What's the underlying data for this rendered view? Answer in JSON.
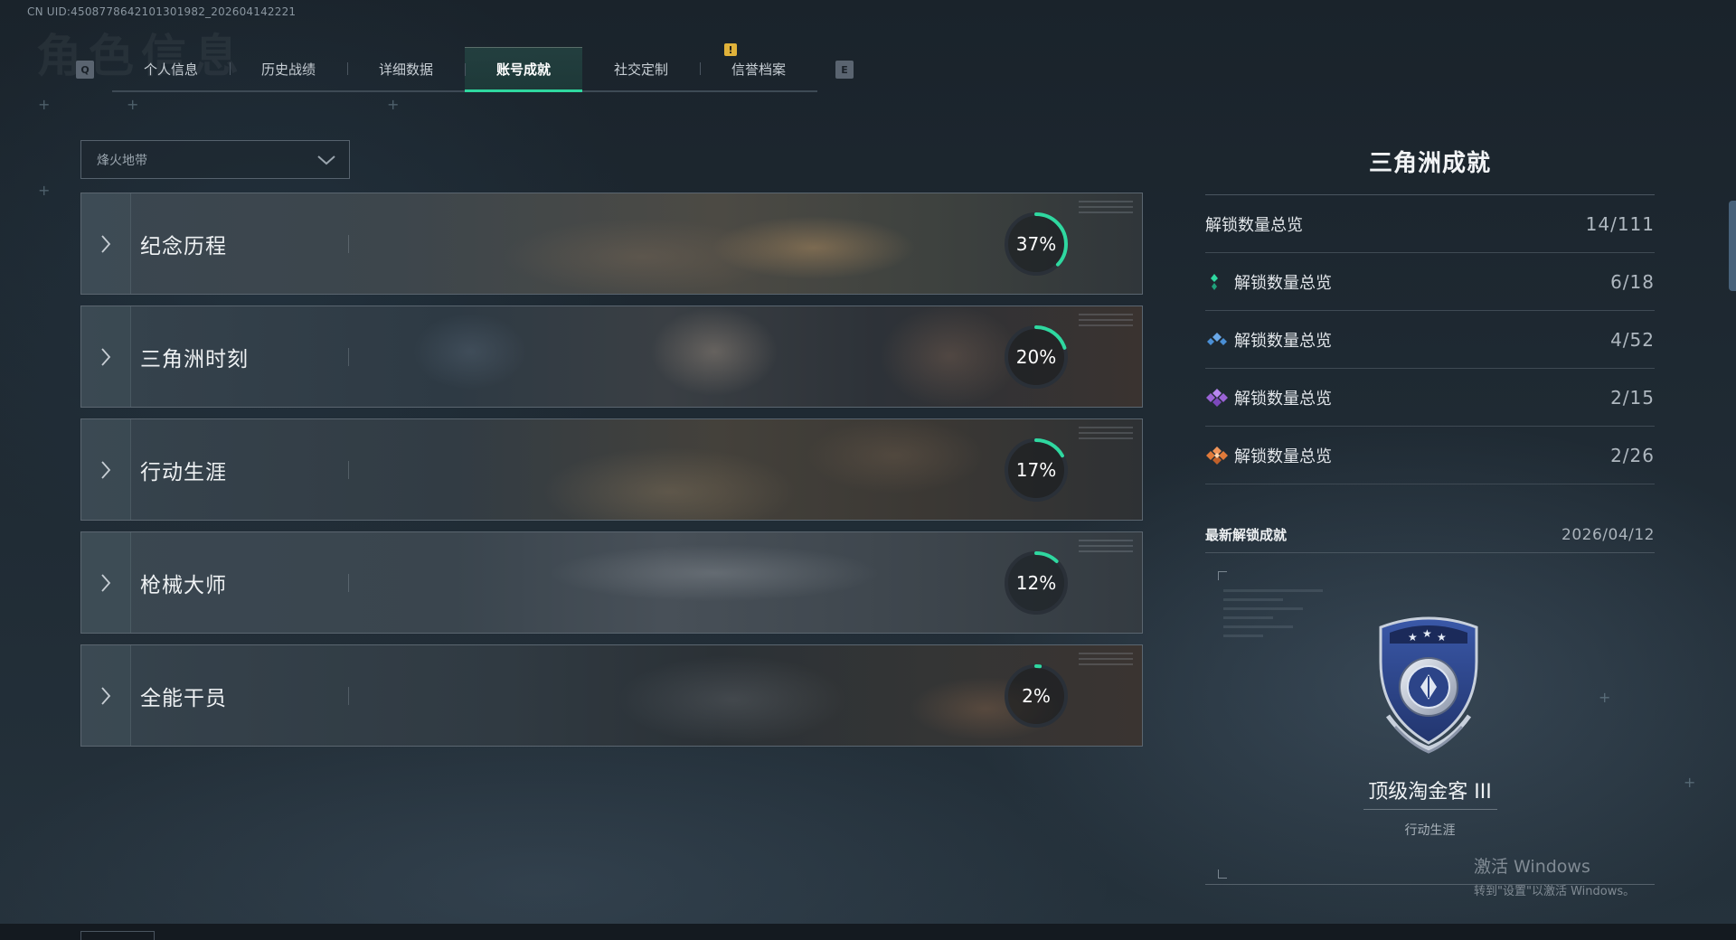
{
  "uid_text": "CN UID:4508778642101301982_202604142221",
  "bg_title": "角色信息",
  "nav": {
    "prev_key": "Q",
    "next_key": "E",
    "tabs": [
      {
        "label": "个人信息",
        "active": false
      },
      {
        "label": "历史战绩",
        "active": false
      },
      {
        "label": "详细数据",
        "active": false
      },
      {
        "label": "账号成就",
        "active": true
      },
      {
        "label": "社交定制",
        "active": false
      },
      {
        "label": "信誉档案",
        "active": false
      }
    ],
    "notice_badge": "!"
  },
  "mode_select": {
    "value": "烽火地带",
    "icon": "chevron-down-icon"
  },
  "categories": [
    {
      "name": "纪念历程",
      "code": "001",
      "percent": 37,
      "percent_label": "37%"
    },
    {
      "name": "三角洲时刻",
      "code": "002",
      "percent": 20,
      "percent_label": "20%"
    },
    {
      "name": "行动生涯",
      "code": "003",
      "percent": 17,
      "percent_label": "17%"
    },
    {
      "name": "枪械大师",
      "code": "004",
      "percent": 12,
      "percent_label": "12%"
    },
    {
      "name": "全能干员",
      "code": "005",
      "percent": 2,
      "percent_label": "2%"
    }
  ],
  "panel": {
    "title": "三角洲成就",
    "total": {
      "label": "解锁数量总览",
      "value": "14/111"
    },
    "tiers": [
      {
        "label": "解锁数量总览",
        "value": "6/18",
        "icon": "green-gem-icon",
        "color": "#2fd8a0"
      },
      {
        "label": "解锁数量总览",
        "value": "4/52",
        "icon": "blue-gem-icon",
        "color": "#4a8fd6"
      },
      {
        "label": "解锁数量总览",
        "value": "2/15",
        "icon": "purple-gem-icon",
        "color": "#9a63d6"
      },
      {
        "label": "解锁数量总览",
        "value": "2/26",
        "icon": "orange-gem-icon",
        "color": "#e07a3a"
      }
    ],
    "latest": {
      "label": "最新解锁成就",
      "date": "2026/04/12",
      "achievement_name": "顶级淘金客 III",
      "achievement_category": "行动生涯"
    }
  },
  "watermark": {
    "line1": "激活 Windows",
    "line2": "转到\"设置\"以激活 Windows。"
  },
  "colors": {
    "accent": "#2fd8a0",
    "ring_track": "#2a3038"
  }
}
